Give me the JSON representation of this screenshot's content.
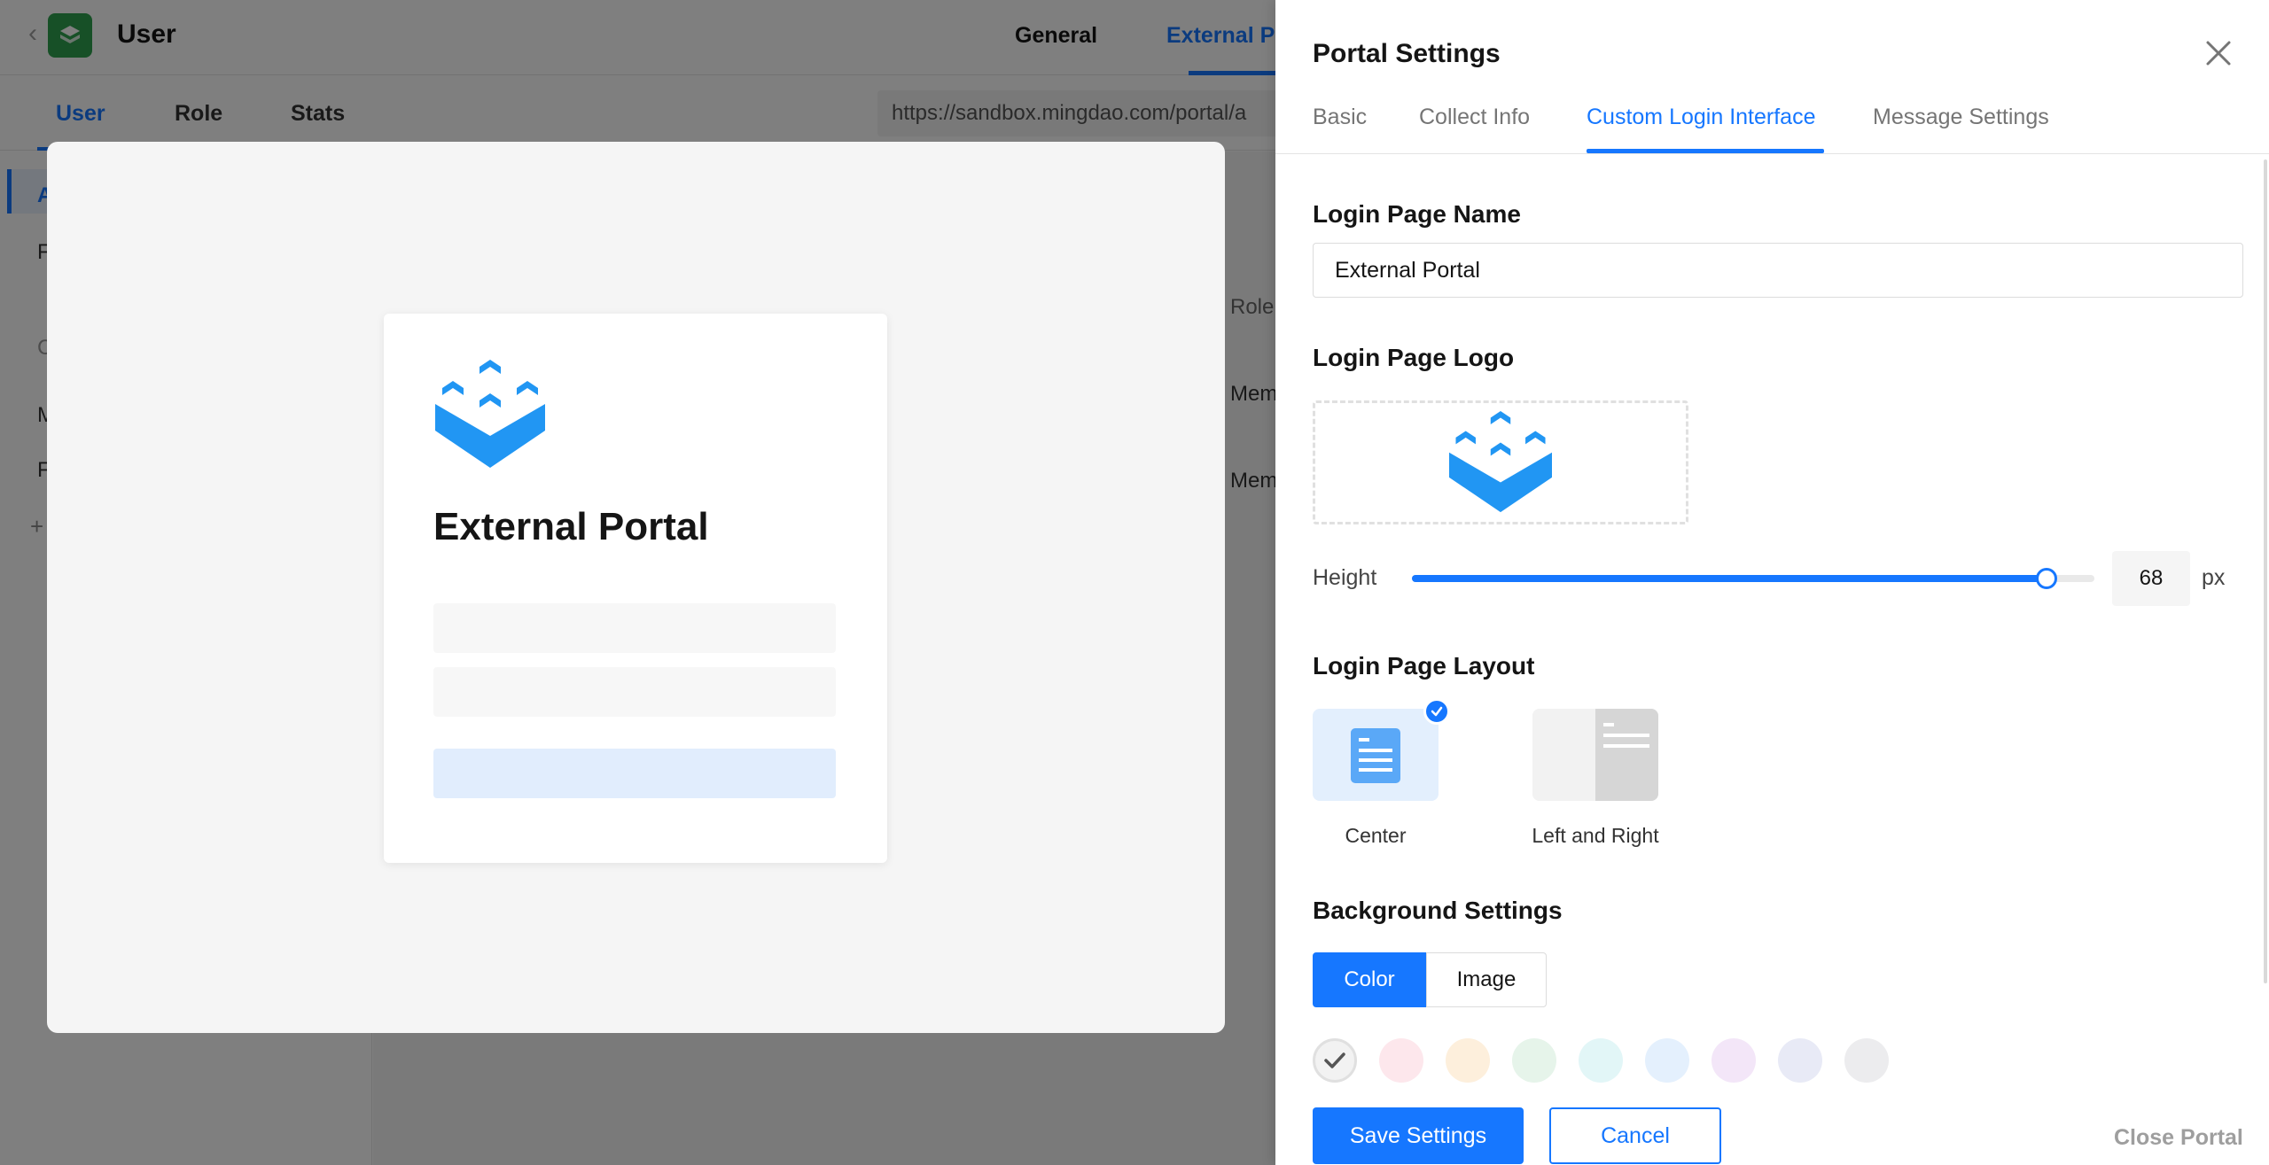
{
  "app": {
    "title": "User",
    "top_tabs": [
      {
        "label": "General"
      },
      {
        "label": "External P"
      }
    ],
    "sub_tabs": [
      {
        "label": "User"
      },
      {
        "label": "Role"
      },
      {
        "label": "Stats"
      }
    ],
    "url": "https://sandbox.mingdao.com/portal/a",
    "sidebar_letters": [
      "A",
      "F",
      "C",
      "M",
      "F",
      "+"
    ],
    "main_texts": {
      "role_header": "Role",
      "member_1": "Mem",
      "member_2": "Mem"
    },
    "brand_color": "#2fa14f"
  },
  "preview": {
    "title": "External Portal",
    "logo": "portal-logo-icon",
    "accent": "#1677ff"
  },
  "drawer": {
    "title": "Portal Settings",
    "close_icon": "close-icon",
    "tabs": [
      {
        "label": "Basic",
        "active": false
      },
      {
        "label": "Collect Info",
        "active": false
      },
      {
        "label": "Custom Login Interface",
        "active": true
      },
      {
        "label": "Message Settings",
        "active": false
      }
    ],
    "login_name": {
      "label": "Login Page Name",
      "value": "External Portal"
    },
    "login_logo": {
      "label": "Login Page Logo",
      "icon": "portal-logo-icon"
    },
    "height": {
      "label": "Height",
      "value": "68",
      "unit": "px",
      "level": 0.93
    },
    "layout": {
      "label": "Login Page Layout",
      "options": [
        {
          "label": "Center",
          "selected": true
        },
        {
          "label": "Left and Right",
          "selected": false
        }
      ]
    },
    "background": {
      "label": "Background Settings",
      "modes": [
        {
          "label": "Color",
          "active": true
        },
        {
          "label": "Image",
          "active": false
        }
      ],
      "swatches": [
        "#f2f2f2",
        "#fde7ec",
        "#fdefdc",
        "#e6f4ea",
        "#e2f6f7",
        "#e4f0fd",
        "#f3e6f8",
        "#e8eaf6",
        "#ececee"
      ]
    },
    "footer": {
      "save_label": "Save Settings",
      "cancel_label": "Cancel",
      "close_portal_label": "Close Portal"
    }
  }
}
